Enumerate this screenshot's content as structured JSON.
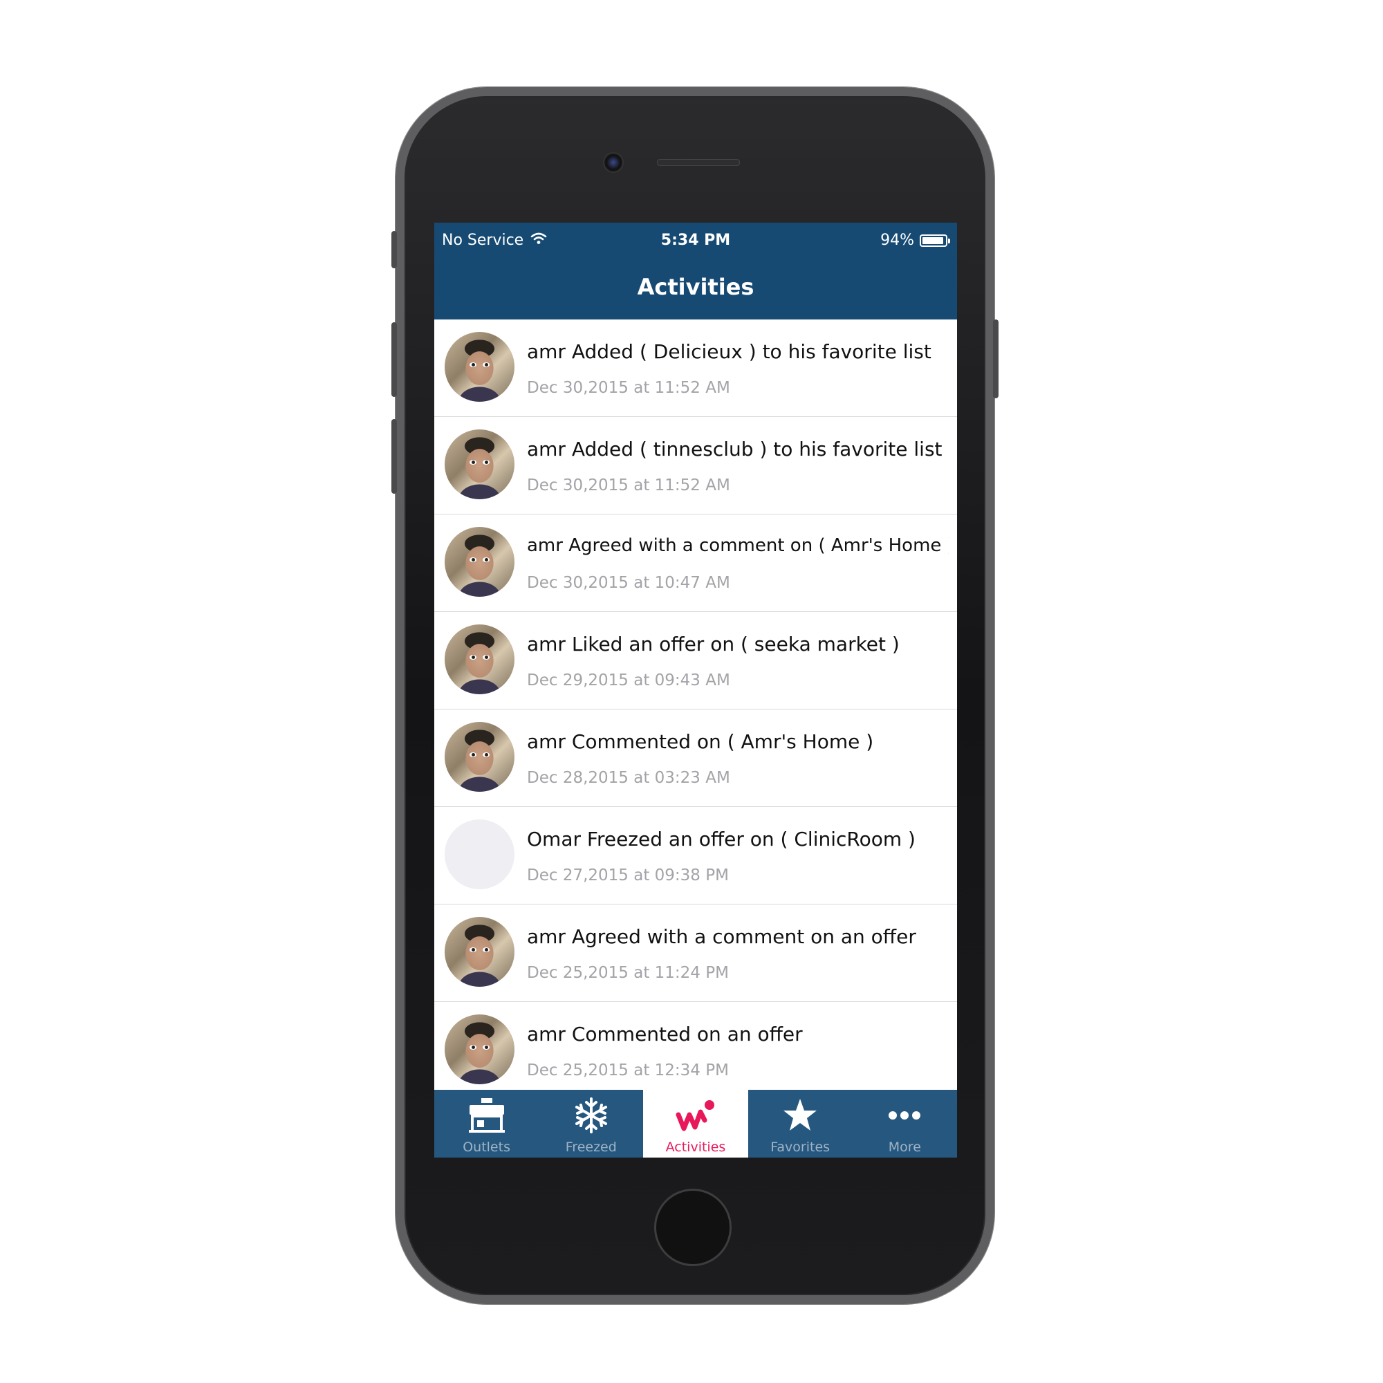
{
  "status_bar": {
    "carrier": "No Service",
    "time": "5:34 PM",
    "battery_percent": "94%",
    "battery_level": 0.94
  },
  "nav": {
    "title": "Activities"
  },
  "activities": [
    {
      "title": "amr Added ( Delicieux ) to his favorite list",
      "date": "Dec 30,2015 at 11:52 AM",
      "avatar": "photo"
    },
    {
      "title": "amr Added ( tinnesclub ) to his favorite list",
      "date": "Dec 30,2015 at 11:52 AM",
      "avatar": "photo"
    },
    {
      "title": "amr Agreed with a comment on ( Amr's Home )",
      "date": "Dec 30,2015 at 10:47 AM",
      "avatar": "photo"
    },
    {
      "title": "amr Liked an offer on ( seeka market )",
      "date": "Dec 29,2015 at 09:43 AM",
      "avatar": "photo"
    },
    {
      "title": "amr Commented on ( Amr's Home )",
      "date": "Dec 28,2015 at 03:23 AM",
      "avatar": "photo"
    },
    {
      "title": "Omar Freezed an offer on ( ClinicRoom )",
      "date": "Dec 27,2015 at 09:38 PM",
      "avatar": "blank"
    },
    {
      "title": "amr Agreed with a comment on an offer",
      "date": "Dec 25,2015 at 11:24 PM",
      "avatar": "photo"
    },
    {
      "title": "amr Commented on an offer",
      "date": "Dec 25,2015 at 12:34 PM",
      "avatar": "photo"
    }
  ],
  "tabs": [
    {
      "label": "Outlets",
      "icon": "store-icon"
    },
    {
      "label": "Freezed",
      "icon": "snowflake-icon"
    },
    {
      "label": "Activities",
      "icon": "activities-icon",
      "active": true
    },
    {
      "label": "Favorites",
      "icon": "star-icon"
    },
    {
      "label": "More",
      "icon": "more-dots-icon"
    }
  ],
  "colors": {
    "nav_background": "#174a73",
    "tab_bar_background": "#26587f",
    "active_tab_color": "#e8185a",
    "inactive_tab_color": "#9fb3c5"
  }
}
